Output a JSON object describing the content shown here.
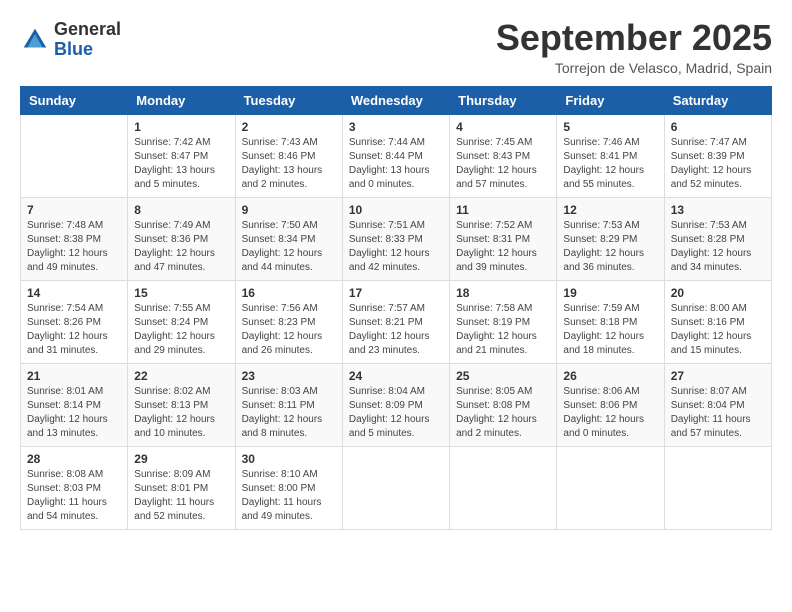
{
  "logo": {
    "general": "General",
    "blue": "Blue"
  },
  "title": "September 2025",
  "location": "Torrejon de Velasco, Madrid, Spain",
  "weekdays": [
    "Sunday",
    "Monday",
    "Tuesday",
    "Wednesday",
    "Thursday",
    "Friday",
    "Saturday"
  ],
  "weeks": [
    [
      {
        "day": "",
        "sunrise": "",
        "sunset": "",
        "daylight": ""
      },
      {
        "day": "1",
        "sunrise": "Sunrise: 7:42 AM",
        "sunset": "Sunset: 8:47 PM",
        "daylight": "Daylight: 13 hours and 5 minutes."
      },
      {
        "day": "2",
        "sunrise": "Sunrise: 7:43 AM",
        "sunset": "Sunset: 8:46 PM",
        "daylight": "Daylight: 13 hours and 2 minutes."
      },
      {
        "day": "3",
        "sunrise": "Sunrise: 7:44 AM",
        "sunset": "Sunset: 8:44 PM",
        "daylight": "Daylight: 13 hours and 0 minutes."
      },
      {
        "day": "4",
        "sunrise": "Sunrise: 7:45 AM",
        "sunset": "Sunset: 8:43 PM",
        "daylight": "Daylight: 12 hours and 57 minutes."
      },
      {
        "day": "5",
        "sunrise": "Sunrise: 7:46 AM",
        "sunset": "Sunset: 8:41 PM",
        "daylight": "Daylight: 12 hours and 55 minutes."
      },
      {
        "day": "6",
        "sunrise": "Sunrise: 7:47 AM",
        "sunset": "Sunset: 8:39 PM",
        "daylight": "Daylight: 12 hours and 52 minutes."
      }
    ],
    [
      {
        "day": "7",
        "sunrise": "Sunrise: 7:48 AM",
        "sunset": "Sunset: 8:38 PM",
        "daylight": "Daylight: 12 hours and 49 minutes."
      },
      {
        "day": "8",
        "sunrise": "Sunrise: 7:49 AM",
        "sunset": "Sunset: 8:36 PM",
        "daylight": "Daylight: 12 hours and 47 minutes."
      },
      {
        "day": "9",
        "sunrise": "Sunrise: 7:50 AM",
        "sunset": "Sunset: 8:34 PM",
        "daylight": "Daylight: 12 hours and 44 minutes."
      },
      {
        "day": "10",
        "sunrise": "Sunrise: 7:51 AM",
        "sunset": "Sunset: 8:33 PM",
        "daylight": "Daylight: 12 hours and 42 minutes."
      },
      {
        "day": "11",
        "sunrise": "Sunrise: 7:52 AM",
        "sunset": "Sunset: 8:31 PM",
        "daylight": "Daylight: 12 hours and 39 minutes."
      },
      {
        "day": "12",
        "sunrise": "Sunrise: 7:53 AM",
        "sunset": "Sunset: 8:29 PM",
        "daylight": "Daylight: 12 hours and 36 minutes."
      },
      {
        "day": "13",
        "sunrise": "Sunrise: 7:53 AM",
        "sunset": "Sunset: 8:28 PM",
        "daylight": "Daylight: 12 hours and 34 minutes."
      }
    ],
    [
      {
        "day": "14",
        "sunrise": "Sunrise: 7:54 AM",
        "sunset": "Sunset: 8:26 PM",
        "daylight": "Daylight: 12 hours and 31 minutes."
      },
      {
        "day": "15",
        "sunrise": "Sunrise: 7:55 AM",
        "sunset": "Sunset: 8:24 PM",
        "daylight": "Daylight: 12 hours and 29 minutes."
      },
      {
        "day": "16",
        "sunrise": "Sunrise: 7:56 AM",
        "sunset": "Sunset: 8:23 PM",
        "daylight": "Daylight: 12 hours and 26 minutes."
      },
      {
        "day": "17",
        "sunrise": "Sunrise: 7:57 AM",
        "sunset": "Sunset: 8:21 PM",
        "daylight": "Daylight: 12 hours and 23 minutes."
      },
      {
        "day": "18",
        "sunrise": "Sunrise: 7:58 AM",
        "sunset": "Sunset: 8:19 PM",
        "daylight": "Daylight: 12 hours and 21 minutes."
      },
      {
        "day": "19",
        "sunrise": "Sunrise: 7:59 AM",
        "sunset": "Sunset: 8:18 PM",
        "daylight": "Daylight: 12 hours and 18 minutes."
      },
      {
        "day": "20",
        "sunrise": "Sunrise: 8:00 AM",
        "sunset": "Sunset: 8:16 PM",
        "daylight": "Daylight: 12 hours and 15 minutes."
      }
    ],
    [
      {
        "day": "21",
        "sunrise": "Sunrise: 8:01 AM",
        "sunset": "Sunset: 8:14 PM",
        "daylight": "Daylight: 12 hours and 13 minutes."
      },
      {
        "day": "22",
        "sunrise": "Sunrise: 8:02 AM",
        "sunset": "Sunset: 8:13 PM",
        "daylight": "Daylight: 12 hours and 10 minutes."
      },
      {
        "day": "23",
        "sunrise": "Sunrise: 8:03 AM",
        "sunset": "Sunset: 8:11 PM",
        "daylight": "Daylight: 12 hours and 8 minutes."
      },
      {
        "day": "24",
        "sunrise": "Sunrise: 8:04 AM",
        "sunset": "Sunset: 8:09 PM",
        "daylight": "Daylight: 12 hours and 5 minutes."
      },
      {
        "day": "25",
        "sunrise": "Sunrise: 8:05 AM",
        "sunset": "Sunset: 8:08 PM",
        "daylight": "Daylight: 12 hours and 2 minutes."
      },
      {
        "day": "26",
        "sunrise": "Sunrise: 8:06 AM",
        "sunset": "Sunset: 8:06 PM",
        "daylight": "Daylight: 12 hours and 0 minutes."
      },
      {
        "day": "27",
        "sunrise": "Sunrise: 8:07 AM",
        "sunset": "Sunset: 8:04 PM",
        "daylight": "Daylight: 11 hours and 57 minutes."
      }
    ],
    [
      {
        "day": "28",
        "sunrise": "Sunrise: 8:08 AM",
        "sunset": "Sunset: 8:03 PM",
        "daylight": "Daylight: 11 hours and 54 minutes."
      },
      {
        "day": "29",
        "sunrise": "Sunrise: 8:09 AM",
        "sunset": "Sunset: 8:01 PM",
        "daylight": "Daylight: 11 hours and 52 minutes."
      },
      {
        "day": "30",
        "sunrise": "Sunrise: 8:10 AM",
        "sunset": "Sunset: 8:00 PM",
        "daylight": "Daylight: 11 hours and 49 minutes."
      },
      {
        "day": "",
        "sunrise": "",
        "sunset": "",
        "daylight": ""
      },
      {
        "day": "",
        "sunrise": "",
        "sunset": "",
        "daylight": ""
      },
      {
        "day": "",
        "sunrise": "",
        "sunset": "",
        "daylight": ""
      },
      {
        "day": "",
        "sunrise": "",
        "sunset": "",
        "daylight": ""
      }
    ]
  ]
}
